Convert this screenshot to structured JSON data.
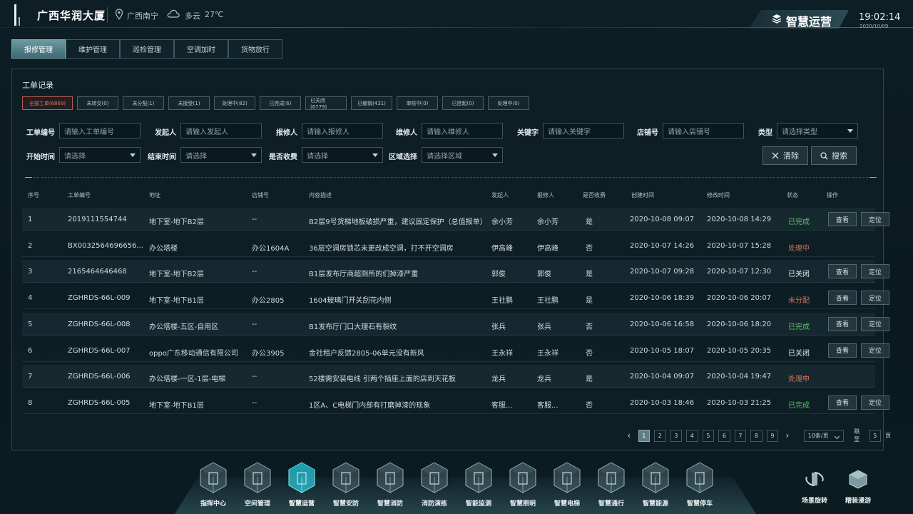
{
  "header": {
    "site_title": "广西华润大厦",
    "location": "广西南宁",
    "weather": "多云",
    "temperature": "27℃",
    "brand": "智慧运营",
    "time": "19:02:14",
    "date": "2020/10/09"
  },
  "tabs": [
    {
      "label": "报修管理",
      "active": true
    },
    {
      "label": "维护管理",
      "active": false
    },
    {
      "label": "巡检管理",
      "active": false
    },
    {
      "label": "空调加时",
      "active": false
    },
    {
      "label": "货物放行",
      "active": false
    }
  ],
  "panel": {
    "title": "工单记录",
    "filters": [
      {
        "label": "全部工单(6869)",
        "active": true
      },
      {
        "label": "未转交(0)",
        "active": false
      },
      {
        "label": "未分配(1)",
        "active": false
      },
      {
        "label": "未接受(1)",
        "active": false
      },
      {
        "label": "处理中(82)",
        "active": false
      },
      {
        "label": "已完成(6)",
        "active": false
      },
      {
        "label": "已关闭(6779)",
        "active": false
      },
      {
        "label": "已撤销(431)",
        "active": false
      },
      {
        "label": "审核中(0)",
        "active": false
      },
      {
        "label": "已挂起(0)",
        "active": false
      },
      {
        "label": "处理中(0)",
        "active": false
      }
    ],
    "form": {
      "order_no": {
        "label": "工单编号",
        "placeholder": "请输入工单编号"
      },
      "initiator": {
        "label": "发起人",
        "placeholder": "请输入发起人"
      },
      "reporter": {
        "label": "报修人",
        "placeholder": "请输入报修人"
      },
      "repairer": {
        "label": "维修人",
        "placeholder": "请输入维修人"
      },
      "keyword": {
        "label": "关键字",
        "placeholder": "请输入关键字"
      },
      "shop_no": {
        "label": "店铺号",
        "placeholder": "请输入店铺号"
      },
      "type": {
        "label": "类型",
        "placeholder": "请选择类型"
      },
      "start_time": {
        "label": "开始时间",
        "placeholder": "请选择"
      },
      "end_time": {
        "label": "结束时间",
        "placeholder": "请选择"
      },
      "charged": {
        "label": "是否收费",
        "placeholder": "请选择"
      },
      "area": {
        "label": "区域选择",
        "placeholder": "请选择区域"
      }
    },
    "clear_label": "清除",
    "search_label": "搜索"
  },
  "table": {
    "headers": [
      "序号",
      "工单编号",
      "地址",
      "店铺号",
      "内容描述",
      "发起人",
      "报修人",
      "是否收费",
      "创建时间",
      "修改时间",
      "状态",
      "操作"
    ],
    "rows": [
      {
        "no": "1",
        "code": "2019111554744",
        "address": "地下室-地下B2层",
        "shop": "--",
        "desc": "B2层9号货梯地板破损严重，建议固定保护（总值报单）",
        "initiator": "余小芳",
        "reporter": "余小芳",
        "charged": "是",
        "created": "2020-10-08 09:07",
        "modified": "2020-10-08 14:29",
        "status": "已完成",
        "status_type": "done",
        "actions": true
      },
      {
        "no": "2",
        "code": "BX0032564696656...",
        "address": "办公塔楼",
        "shop": "办公1604A",
        "desc": "36层空调房锁芯未更改成空调，打不开空调房",
        "initiator": "伊高峰",
        "reporter": "伊高峰",
        "charged": "否",
        "created": "2020-10-07 14:26",
        "modified": "2020-10-07 15:28",
        "status": "处理中",
        "status_type": "proc",
        "actions": false
      },
      {
        "no": "3",
        "code": "2165464646468",
        "address": "地下室-地下B2层",
        "shop": "--",
        "desc": "B1层发布厅商超厕所的们掉漆严重",
        "initiator": "郭俊",
        "reporter": "郭俊",
        "charged": "是",
        "created": "2020-10-07 09:28",
        "modified": "2020-10-07 12:30",
        "status": "已关闭",
        "status_type": "closed",
        "actions": true
      },
      {
        "no": "4",
        "code": "ZGHRDS-66L-009",
        "address": "地下室-地下B1层",
        "shop": "办公2805",
        "desc": "1604玻璃门开关刮花内侧",
        "initiator": "王社鹏",
        "reporter": "王社鹏",
        "charged": "是",
        "created": "2020-10-06 18:39",
        "modified": "2020-10-06 20:07",
        "status": "未分配",
        "status_type": "unassigned",
        "actions": true
      },
      {
        "no": "5",
        "code": "ZGHRDS-66L-008",
        "address": "办公塔楼-五区-自用区",
        "shop": "--",
        "desc": "B1发布厅门口大理石有裂纹",
        "initiator": "张兵",
        "reporter": "张兵",
        "charged": "否",
        "created": "2020-10-06 16:58",
        "modified": "2020-10-06 18:20",
        "status": "已完成",
        "status_type": "done",
        "actions": true
      },
      {
        "no": "6",
        "code": "ZGHRDS-66L-007",
        "address": "oppo广东移动通信有限公司",
        "shop": "办公3905",
        "desc": "金社租户反馈2805-06单元没有新风",
        "initiator": "王永祥",
        "reporter": "王永祥",
        "charged": "否",
        "created": "2020-10-05 18:07",
        "modified": "2020-10-05 20:35",
        "status": "已关闭",
        "status_type": "closed",
        "actions": true
      },
      {
        "no": "7",
        "code": "ZGHRDS-66L-006",
        "address": "办公塔楼-一区-1层-电梯",
        "shop": "--",
        "desc": "52楼需安装电线 引两个插座上面的店到天花板",
        "initiator": "龙兵",
        "reporter": "龙兵",
        "charged": "是",
        "created": "2020-10-04 09:07",
        "modified": "2020-10-04 19:47",
        "status": "处理中",
        "status_type": "proc",
        "actions": false
      },
      {
        "no": "8",
        "code": "ZGHRDS-66L-005",
        "address": "地下室-地下B1层",
        "shop": "--",
        "desc": "1区A、C电梯门内部有打磨掉漆的现象",
        "initiator": "客服...",
        "reporter": "客服...",
        "charged": "否",
        "created": "2020-10-03 18:46",
        "modified": "2020-10-03 21:25",
        "status": "已完成",
        "status_type": "done",
        "actions": true
      }
    ],
    "view_label": "查看",
    "locate_label": "定位"
  },
  "pagination": {
    "pages": [
      "1",
      "2",
      "3",
      "4",
      "5",
      "6",
      "7",
      "8",
      "9"
    ],
    "current": "1",
    "per_page": "10条/页",
    "goto_label": "跳至",
    "goto_value": "5",
    "page_suffix": "页"
  },
  "dock": [
    {
      "label": "指挥中心",
      "icon": "command-center-icon",
      "active": false
    },
    {
      "label": "空间管理",
      "icon": "space-management-icon",
      "active": false
    },
    {
      "label": "智慧运营",
      "icon": "smart-operation-icon",
      "active": true
    },
    {
      "label": "智慧安防",
      "icon": "smart-security-icon",
      "active": false
    },
    {
      "label": "智慧消防",
      "icon": "smart-fire-icon",
      "active": false
    },
    {
      "label": "消防演练",
      "icon": "fire-drill-icon",
      "active": false
    },
    {
      "label": "智能监测",
      "icon": "smart-monitor-icon",
      "active": false
    },
    {
      "label": "智慧照明",
      "icon": "smart-lighting-icon",
      "active": false
    },
    {
      "label": "智慧电梯",
      "icon": "smart-elevator-icon",
      "active": false
    },
    {
      "label": "智慧通行",
      "icon": "smart-access-icon",
      "active": false
    },
    {
      "label": "智慧能源",
      "icon": "smart-energy-icon",
      "active": false
    },
    {
      "label": "智慧停车",
      "icon": "smart-parking-icon",
      "active": false
    }
  ],
  "side_tools": [
    {
      "label": "场景旋转",
      "icon": "scene-rotate-icon"
    },
    {
      "label": "精装漫游",
      "icon": "roaming-icon"
    }
  ],
  "colors": {
    "accent": "#5e8f99",
    "done": "#5fbf6d",
    "processing": "#d8735a",
    "active_dock": "#2ec6d6"
  }
}
